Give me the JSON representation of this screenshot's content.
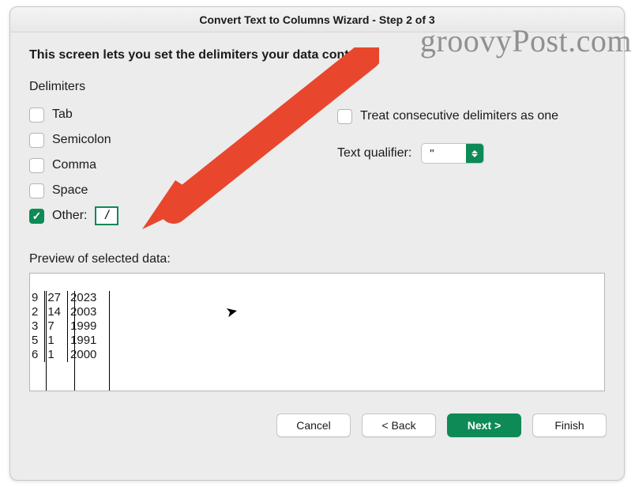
{
  "title": "Convert Text to Columns Wizard - Step 2 of 3",
  "watermark": "groovyPost.com",
  "header": "This screen lets you set the delimiters your data contains.",
  "delimiters_label": "Delimiters",
  "delimiters": {
    "tab": {
      "label": "Tab",
      "checked": false
    },
    "semicolon": {
      "label": "Semicolon",
      "checked": false
    },
    "comma": {
      "label": "Comma",
      "checked": false
    },
    "space": {
      "label": "Space",
      "checked": false
    },
    "other": {
      "label": "Other:",
      "checked": true,
      "value": "/"
    }
  },
  "treat_consecutive": {
    "label": "Treat consecutive delimiters as one",
    "checked": false
  },
  "qualifier": {
    "label": "Text qualifier:",
    "value": "\""
  },
  "preview_label": "Preview of selected data:",
  "preview_rows": [
    [
      "9",
      "27",
      "2023"
    ],
    [
      "2",
      "14",
      "2003"
    ],
    [
      "3",
      "7",
      "1999"
    ],
    [
      "5",
      "1",
      "1991"
    ],
    [
      "6",
      "1",
      "2000"
    ]
  ],
  "buttons": {
    "cancel": "Cancel",
    "back": "< Back",
    "next": "Next >",
    "finish": "Finish"
  }
}
